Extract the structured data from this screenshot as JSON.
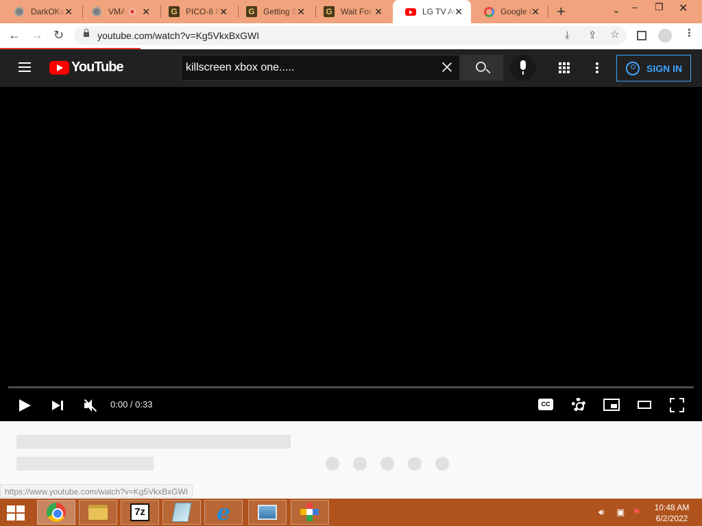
{
  "tabs": [
    {
      "title": "DarkOKx",
      "favicon": "globe-icon"
    },
    {
      "title": "VMA",
      "favicon": "globe-icon",
      "recording": true
    },
    {
      "title": "PICO-8 F",
      "favicon": "g-icon"
    },
    {
      "title": "Getting S",
      "favicon": "g-icon"
    },
    {
      "title": "Wait For",
      "favicon": "g-icon"
    },
    {
      "title": "LG TV An",
      "favicon": "youtube-icon",
      "active": true
    },
    {
      "title": "Google C",
      "favicon": "google-icon"
    }
  ],
  "address_bar": {
    "url": "youtube.com/watch?v=Kg5VkxBxGWI"
  },
  "youtube": {
    "logo_text": "YouTube",
    "search_value": "killscreen xbox one.....",
    "sign_in_label": "SIGN IN"
  },
  "player": {
    "time": "0:00 / 0:33",
    "cc_label": "CC"
  },
  "status_bar": {
    "url": "https://www.youtube.com/watch?v=Kg5VkxBxGWI"
  },
  "taskbar": {
    "apps": [
      "chrome",
      "file-explorer",
      "7-zip",
      "notepad",
      "internet-explorer",
      "image-viewer",
      "paint"
    ],
    "sevenzip_label": "7z",
    "ie_label": "e",
    "time": "10:48 AM",
    "date": "6/2/2022"
  },
  "colors": {
    "tab_strip": "#f0a37c",
    "youtube_header": "#212121",
    "accent_blue": "#3ea6ff",
    "youtube_red": "#ff0000",
    "taskbar": "#b0521c"
  }
}
